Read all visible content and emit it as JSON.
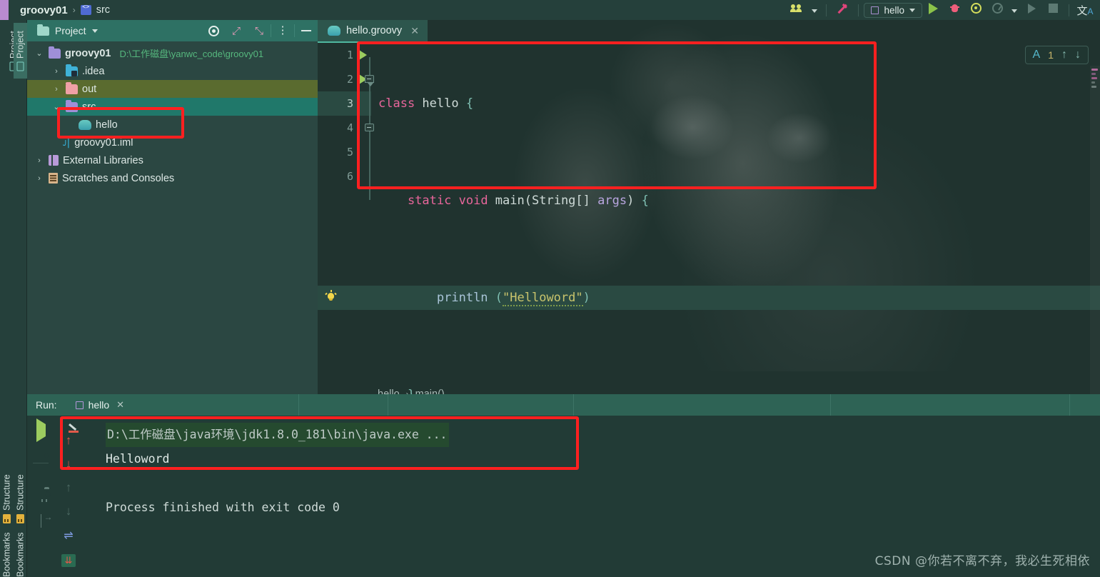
{
  "window": {
    "breadcrumb": {
      "project": "groovy01",
      "separator": "›",
      "node": "src"
    }
  },
  "toolbar": {
    "people_icon": "people-icon",
    "people_caret": "▾",
    "build_icon": "hammer-icon",
    "run_config": {
      "label": "hello",
      "caret": "▾"
    },
    "run_icon": "run-icon",
    "debug_icon": "debug-bug-icon",
    "coverage_icon": "run-with-coverage-icon",
    "profiler_icon": "profiler-icon",
    "profiler_caret": "▾",
    "rerun_icon": "rerun-icon",
    "stop_icon": "stop-icon",
    "translate_icon": "translate-icon",
    "translate_glyph": "文",
    "translate_sub": "A"
  },
  "left_strip": {
    "tabs": [
      {
        "label": "Project",
        "icon": "monitor-icon",
        "active": false
      },
      {
        "label": "Project",
        "icon": "monitor-icon",
        "active": true
      }
    ],
    "bottom_tabs": [
      {
        "label": "Structure",
        "icon": "structure-icon"
      },
      {
        "label": "Structure",
        "icon": "structure-icon"
      },
      {
        "label": "Bookmarks",
        "icon": "bookmarks-icon"
      },
      {
        "label": "Bookmarks",
        "icon": "bookmarks-icon"
      }
    ]
  },
  "project_panel": {
    "title": "Project",
    "title_caret": "▾",
    "tools": [
      {
        "name": "select-opened-file-icon",
        "glyph": "◎"
      },
      {
        "name": "expand-all-icon",
        "glyph": "⤢"
      },
      {
        "name": "collapse-all-icon",
        "glyph": "⤡"
      },
      {
        "name": "options-menu-icon",
        "glyph": "⋮"
      },
      {
        "name": "hide-panel-icon",
        "glyph": "—"
      }
    ],
    "tree": [
      {
        "label": "groovy01",
        "path": "D:\\工作磁盘\\yanwc_code\\groovy01",
        "arrow": "⌄",
        "icon": "folder-icon",
        "indent": 0,
        "bold": true,
        "state": "normal"
      },
      {
        "label": ".idea",
        "arrow": "›",
        "icon": "folder-idea-icon",
        "indent": 1,
        "state": "normal"
      },
      {
        "label": "out",
        "arrow": "›",
        "icon": "folder-out-icon",
        "indent": 1,
        "state": "highlight-olive"
      },
      {
        "label": "src",
        "arrow": "⌄",
        "icon": "folder-source-icon",
        "indent": 1,
        "state": "highlight-teal"
      },
      {
        "label": "hello",
        "arrow": "",
        "icon": "groovy-file-icon",
        "indent": 2,
        "state": "normal"
      },
      {
        "label": "groovy01.iml",
        "arrow": "",
        "icon": "iml-file-icon",
        "indent": 1,
        "state": "normal"
      },
      {
        "label": "External Libraries",
        "arrow": "›",
        "icon": "library-icon",
        "indent": 0,
        "state": "normal"
      },
      {
        "label": "Scratches and Consoles",
        "arrow": "›",
        "icon": "scratches-icon",
        "indent": 0,
        "state": "normal"
      }
    ]
  },
  "editor": {
    "tab": {
      "label": "hello.groovy",
      "icon": "groovy-file-icon",
      "close": "✕"
    },
    "lines": [
      {
        "number": "1",
        "run_marker": true,
        "fold": null,
        "bulb": false,
        "highlight": false
      },
      {
        "number": "2",
        "run_marker": true,
        "fold": "collapse-start",
        "bulb": false,
        "highlight": false
      },
      {
        "number": "3",
        "run_marker": false,
        "fold": null,
        "bulb": true,
        "highlight": true
      },
      {
        "number": "4",
        "run_marker": false,
        "fold": "collapse-end",
        "bulb": false,
        "highlight": false
      },
      {
        "number": "5",
        "run_marker": false,
        "fold": null,
        "bulb": false,
        "highlight": false
      },
      {
        "number": "6",
        "run_marker": false,
        "fold": null,
        "bulb": false,
        "highlight": false
      }
    ],
    "code": {
      "l1_kw": "class",
      "l1_name": " hello ",
      "l1_brace": "{",
      "l2_kw1": "static",
      "l2_kw2": " void",
      "l2_name": " main",
      "l2_paren1": "(",
      "l2_type": "String[]",
      "l2_arg": " args",
      "l2_paren2": ")",
      "l2_brace": " {",
      "l3_call": "println",
      "l3_paren1": " (",
      "l3_str": "\"Helloword\"",
      "l3_paren2": ")",
      "l4_brace": "}",
      "l5_brace": "}"
    },
    "inspection_widget": {
      "icon": "inspections-ok-icon",
      "glyph": "A",
      "count": "1",
      "prev_glyph": "↑",
      "next_glyph": "↓"
    },
    "breadcrumb": {
      "class": "hello",
      "sep": "›",
      "method": "main()"
    }
  },
  "run_panel": {
    "label": "Run:",
    "tab": {
      "label": "hello",
      "close": "✕"
    },
    "side_actions": [
      {
        "name": "rerun-icon",
        "glyph": "▶"
      },
      {
        "name": "run-settings-gear-icon",
        "glyph": "⚙"
      },
      {
        "name": "stop-icon",
        "glyph": "■"
      },
      {
        "name": "screenshot-icon",
        "glyph": "📷"
      },
      {
        "name": "disconnect-plug-icon",
        "glyph": "🔌"
      },
      {
        "name": "export-icon",
        "glyph": "⇥"
      }
    ],
    "console_actions": [
      {
        "name": "soft-wrap-pen-icon",
        "glyph": "✎"
      },
      {
        "name": "previous-occurrence-icon",
        "glyph": "↑"
      },
      {
        "name": "next-occurrence-icon",
        "glyph": "↓"
      },
      {
        "name": "up-grey-icon",
        "glyph": "↑"
      },
      {
        "name": "down-grey-icon",
        "glyph": "↓"
      },
      {
        "name": "soft-wrap-icon",
        "glyph": "⇌"
      },
      {
        "name": "scroll-to-end-icon",
        "glyph": "⇊"
      }
    ],
    "console": {
      "command": "D:\\工作磁盘\\java环境\\jdk1.8.0_181\\bin\\java.exe ...",
      "output": "Helloword",
      "finished": "Process finished with exit code 0"
    }
  },
  "watermark": {
    "text": "CSDN @你若不离不弃，我必生死相依"
  },
  "colors": {
    "accent_green": "#4fb8a0",
    "annotation_red": "#ff2020",
    "keyword_pink": "#e8669b",
    "string_yellow": "#c9c46c",
    "path_green": "#56b87e"
  }
}
